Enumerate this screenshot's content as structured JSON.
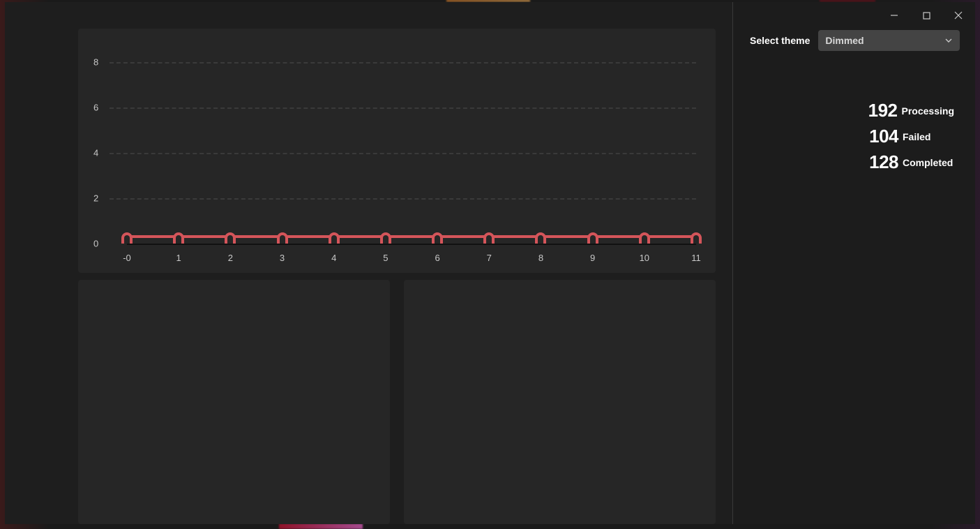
{
  "window": {},
  "sidebar": {
    "theme_label": "Select theme",
    "theme_value": "Dimmed",
    "stats": [
      {
        "value": "192",
        "label": "Processing"
      },
      {
        "value": "104",
        "label": "Failed"
      },
      {
        "value": "128",
        "label": "Completed"
      }
    ]
  },
  "chart_data": {
    "type": "line",
    "x": [
      0,
      1,
      2,
      3,
      4,
      5,
      6,
      7,
      8,
      9,
      10,
      11
    ],
    "values": [
      0,
      0,
      0,
      0,
      0,
      0,
      0,
      0,
      0,
      0,
      0,
      0
    ],
    "x_tick_labels": [
      "-0",
      "1",
      "2",
      "3",
      "4",
      "5",
      "6",
      "7",
      "8",
      "9",
      "10",
      "11"
    ],
    "y_ticks": [
      0,
      2,
      4,
      6,
      8
    ],
    "ylim": [
      0,
      8
    ],
    "xlim": [
      0,
      11
    ],
    "series_color": "#d4555a"
  }
}
